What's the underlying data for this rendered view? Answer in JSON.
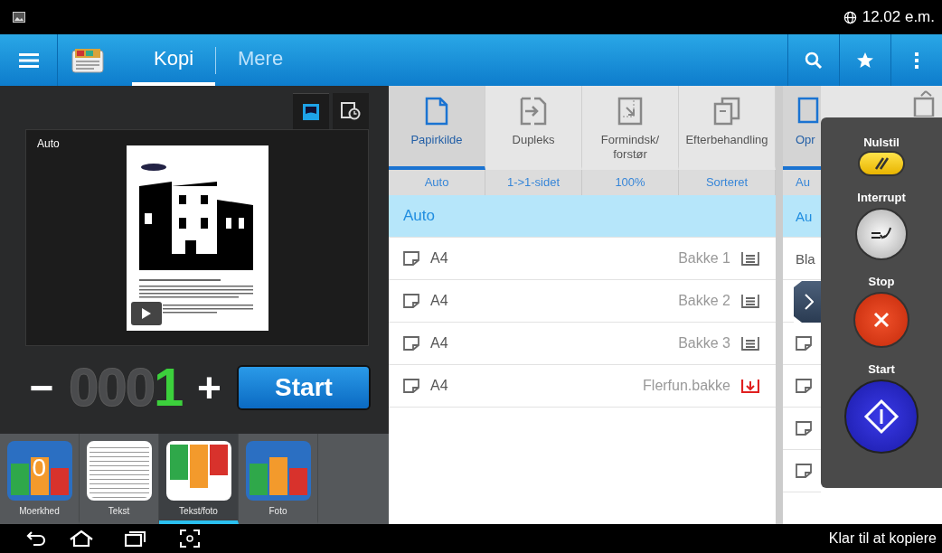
{
  "status_bar": {
    "time": "12.02 e.m."
  },
  "action_bar": {
    "tabs": [
      {
        "label": "Kopi",
        "selected": true
      },
      {
        "label": "Mere",
        "selected": false
      }
    ]
  },
  "preview": {
    "tabs": [
      {
        "kind": "preview",
        "selected": true
      },
      {
        "kind": "history",
        "selected": false
      }
    ],
    "label": "Auto"
  },
  "copies": {
    "minus": "−",
    "dim_digits": "000",
    "digit": "1",
    "plus": "+",
    "start": "Start"
  },
  "modes": [
    {
      "label": "Moerkhed",
      "kind": "photo",
      "badge": "0",
      "selected": false
    },
    {
      "label": "Tekst",
      "kind": "document",
      "selected": false
    },
    {
      "label": "Tekst/foto",
      "kind": "mixed",
      "selected": true
    },
    {
      "label": "Foto",
      "kind": "photo",
      "selected": false
    }
  ],
  "settings_tabs": [
    {
      "label": "Papirkilde",
      "value": "Auto",
      "kind": "paper",
      "selected": true
    },
    {
      "label": "Dupleks",
      "value": "1->1-sidet",
      "kind": "duplex",
      "selected": false
    },
    {
      "label": "Formindsk/ forstør",
      "value": "100%",
      "kind": "scale",
      "selected": false
    },
    {
      "label": "Efterbehandling",
      "value": "Sorteret",
      "kind": "finishing",
      "selected": false
    }
  ],
  "paper_list": [
    {
      "kind": "auto",
      "label": "Auto",
      "selected": true
    },
    {
      "kind": "tray",
      "label": "A4",
      "tray": "Bakke 1",
      "selected": false
    },
    {
      "kind": "tray",
      "label": "A4",
      "tray": "Bakke 2",
      "selected": false
    },
    {
      "kind": "tray",
      "label": "A4",
      "tray": "Bakke 3",
      "selected": false
    },
    {
      "kind": "manual",
      "label": "A4",
      "tray": "Flerfun.bakke",
      "selected": false
    }
  ],
  "original_tabs": [
    {
      "label": "Opr",
      "value": "Au",
      "kind": "size",
      "selected": true
    },
    {
      "kind": "orientation",
      "selected": false
    }
  ],
  "original_list": [
    {
      "kind": "auto",
      "label": "Au",
      "selected": true
    },
    {
      "kind": "plain",
      "label": "Bla",
      "selected": false
    },
    {
      "kind": "covered",
      "selected": false
    },
    {
      "kind": "size",
      "selected": false
    },
    {
      "kind": "size",
      "selected": false
    },
    {
      "kind": "size",
      "selected": false
    },
    {
      "kind": "size",
      "selected": false
    }
  ],
  "quick_panel": [
    {
      "kind": "reset",
      "label": "Nulstil"
    },
    {
      "kind": "interrupt",
      "label": "Interrupt"
    },
    {
      "kind": "stop",
      "label": "Stop"
    },
    {
      "kind": "start",
      "label": "Start"
    }
  ],
  "nav_bar": {
    "status": "Klar til at kopiere"
  }
}
